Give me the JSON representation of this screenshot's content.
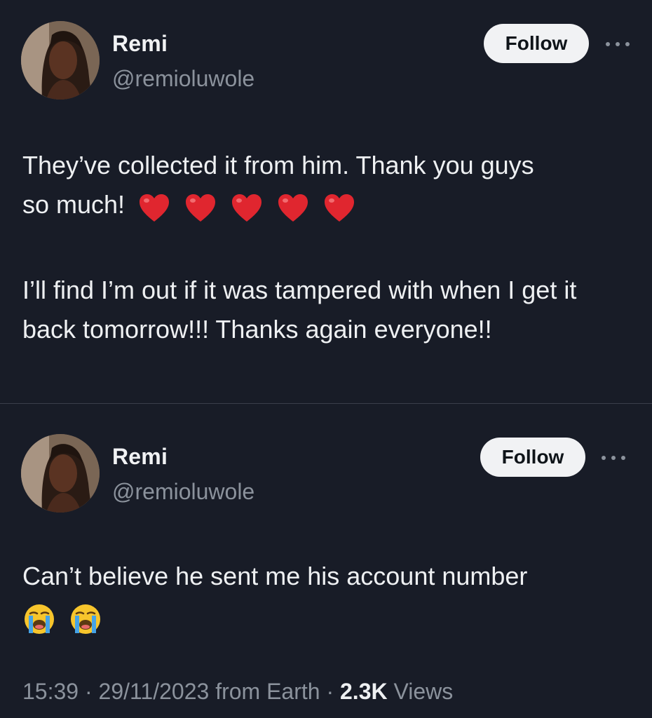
{
  "tweets": [
    {
      "author": {
        "name": "Remi",
        "handle": "@remioluwole"
      },
      "follow_label": "Follow",
      "text_line1": "They’ve collected it from him. Thank you guys",
      "text_line2": "so much!",
      "text_emojis": [
        "red-heart",
        "red-heart",
        "red-heart",
        "red-heart",
        "red-heart"
      ],
      "text_paragraph2": "I’ll find I’m out if it was tampered with when I get it back tomorrow!!! Thanks again everyone!!"
    },
    {
      "author": {
        "name": "Remi",
        "handle": "@remioluwole"
      },
      "follow_label": "Follow",
      "text_line1": "Can’t believe he sent me his account number",
      "text_emojis": [
        "loudly-crying-face",
        "loudly-crying-face"
      ],
      "meta": {
        "time": "15:39",
        "date": "29/11/2023",
        "source": "from Earth",
        "views_count": "2.3K",
        "views_label": "Views"
      }
    }
  ],
  "colors": {
    "background": "#181c27",
    "text": "#eef0f2",
    "muted": "#8b929c",
    "follow_bg": "#f1f2f4",
    "heart": "#e0262f",
    "cry_face": "#f7c52c",
    "tears": "#45a3e6"
  },
  "icons": {
    "more": "more-horizontal-icon"
  }
}
